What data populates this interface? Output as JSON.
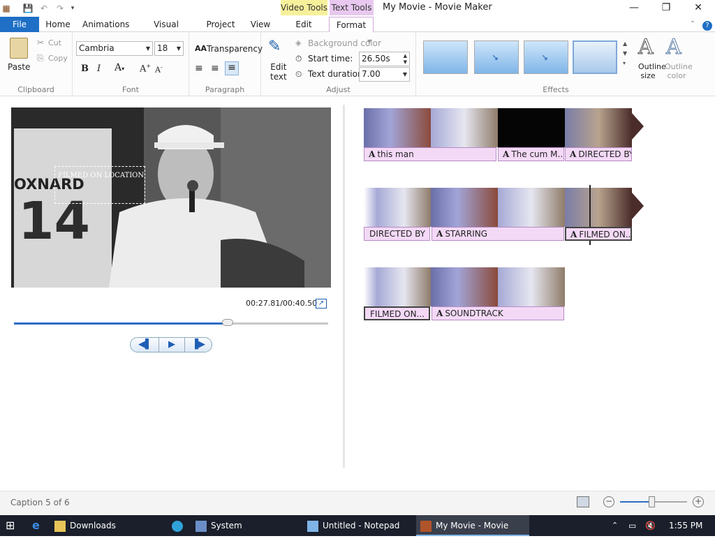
{
  "titlebar": {
    "window_title": "My Movie - Movie Maker",
    "context_video_tools": "Video Tools",
    "context_text_tools": "Text Tools"
  },
  "tabs": {
    "file": "File",
    "home": "Home",
    "animations": "Animations",
    "visual_effects": "Visual Effects",
    "project": "Project",
    "view": "View",
    "edit": "Edit",
    "format": "Format"
  },
  "ribbon": {
    "clipboard": {
      "label": "Clipboard",
      "paste": "Paste",
      "cut": "Cut",
      "copy": "Copy"
    },
    "font": {
      "label": "Font",
      "family": "Cambria",
      "size": "18"
    },
    "paragraph": {
      "label": "Paragraph",
      "transparency": "Transparency"
    },
    "adjust": {
      "label": "Adjust",
      "edit_text": "Edit\ntext",
      "background_color": "Background color",
      "start_time_label": "Start time:",
      "start_time_value": "26.50s",
      "text_duration_label": "Text duration:",
      "text_duration_value": "7.00"
    },
    "effects": {
      "label": "Effects",
      "outline_size": "Outline size",
      "outline_color": "Outline color"
    }
  },
  "preview": {
    "overlay_text": "FILMED ON LOCATION",
    "jersey_name": "OXNARD",
    "jersey_number": "14",
    "time": "00:27.81/00:40.50",
    "progress": 0.68
  },
  "timeline": {
    "row1_captions": [
      "this man",
      "The cum M...",
      "DIRECTED BY"
    ],
    "row2_captions": [
      "DIRECTED BY",
      "STARRING",
      "FILMED ON..."
    ],
    "row3_captions": [
      "FILMED ON...",
      "SOUNDTRACK"
    ]
  },
  "status": {
    "caption_position": "Caption 5 of 6"
  },
  "taskbar": {
    "downloads": "Downloads",
    "system": "System",
    "notepad": "Untitled - Notepad",
    "moviemaker": "My Movie - Movie Ma...",
    "clock": "1:55 PM"
  },
  "colors": {
    "file_tab": "#1e6fc5",
    "video_tools": "#f7f09b",
    "text_tools": "#e8c8ee",
    "caption_fill": "#f4d9f7",
    "seek_fill": "#2e6cc4"
  }
}
